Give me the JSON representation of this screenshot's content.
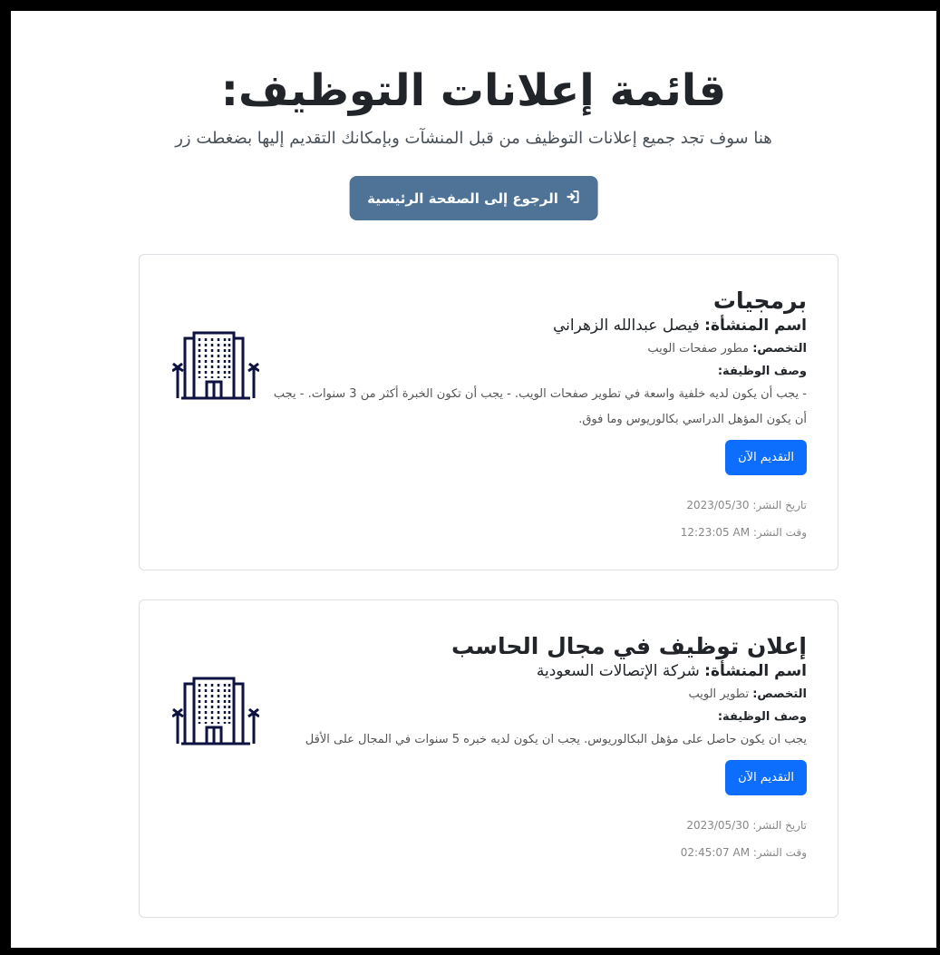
{
  "header": {
    "title": "قائمة إعلانات التوظيف:",
    "subtitle": "هنا سوف تجد جميع إعلانات التوظيف من قبل المنشآت وبإمكانك التقديم إليها بضغطت زر",
    "home_button_label": "الرجوع إلى الصفحة الرئيسية",
    "home_button_icon": "sign-in-icon"
  },
  "labels": {
    "company": "اسم المنشأة:",
    "specialty": "التخصص:",
    "description": "وصف الوظيفة:",
    "apply": "التقديم الآن",
    "posted_date": "تاريخ النشر:",
    "posted_time": "وقت النشر:"
  },
  "jobs": [
    {
      "title": "برمجيات",
      "company": "فيصل عبدالله الزهراني",
      "specialty": "مطور صفحات الويب",
      "description": "- يجب أن يكون لديه خلفية واسعة في تطوير صفحات الويب. - يجب أن تكون الخبرة أكثر من 3 سنوات. - يجب أن يكون المؤهل الدراسي بكالوريوس وما فوق.",
      "date": "2023/05/30",
      "time": "12:23:05 AM",
      "icon": "building-icon"
    },
    {
      "title": "إعلان توظيف في مجال الحاسب",
      "company": "شركة الإتصالات السعودية",
      "specialty": "تطوير الويب",
      "description": "يجب ان يكون حاصل على مؤهل البكالوريوس. يجب ان يكون لديه خبره 5 سنوات في المجال على الأقل",
      "date": "2023/05/30",
      "time": "02:45:07 AM",
      "icon": "building-icon"
    }
  ],
  "colors": {
    "home_button": "#4e7396",
    "apply_button": "#0d6efd",
    "building_icon": "#0d1240"
  }
}
